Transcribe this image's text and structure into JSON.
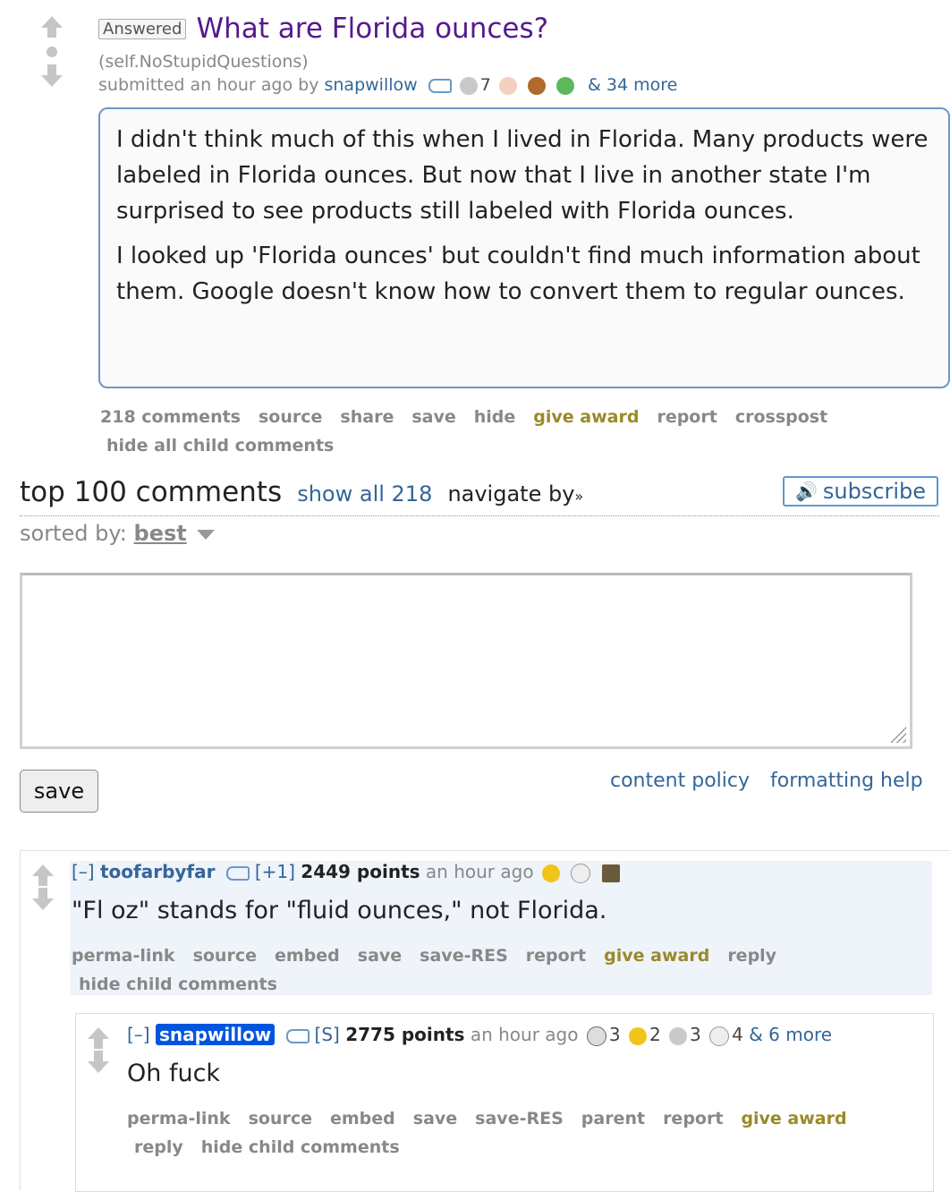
{
  "post": {
    "flair": "Answered",
    "title": "What are Florida ounces?",
    "domain": "(self.NoStupidQuestions)",
    "submitted": "submitted an hour ago by",
    "author": "snapwillow",
    "award_count_1": "7",
    "more_awards": "& 34 more",
    "body_p1": "I didn't think much of this when I lived in Florida. Many products were labeled in Florida ounces. But now that I live in another state I'm surprised to see products still labeled with Florida ounces.",
    "body_p2": "I looked up 'Florida ounces' but couldn't find much information about them. Google doesn't know how to convert them to regular ounces.",
    "buttons": {
      "comments": "218 comments",
      "source": "source",
      "share": "share",
      "save": "save",
      "hide": "hide",
      "give_award": "give award",
      "report": "report",
      "crosspost": "crosspost",
      "hide_child": "hide all child comments"
    }
  },
  "comments_panel": {
    "title": "top 100 comments",
    "show_all": "show all 218",
    "navigate": "navigate by",
    "subscribe": "subscribe",
    "sorted_by_label": "sorted by:",
    "sort_value": "best",
    "save_label": "save",
    "content_policy": "content policy",
    "formatting_help": "formatting help"
  },
  "comment1": {
    "collapse": "[–]",
    "author": "toofarbyfar",
    "karma": "[+1]",
    "points": "2449 points",
    "time": "an hour ago",
    "body": "\"Fl oz\" stands for \"fluid ounces,\" not Florida.",
    "buttons": {
      "permalink": "perma-link",
      "source": "source",
      "embed": "embed",
      "save": "save",
      "save_res": "save-RES",
      "report": "report",
      "give_award": "give award",
      "reply": "reply",
      "hide_child": "hide child comments"
    }
  },
  "comment2": {
    "collapse": "[–]",
    "author": "snapwillow",
    "tag": "[S]",
    "points": "2775 points",
    "time": "an hour ago",
    "award1": "3",
    "award2": "2",
    "award3": "3",
    "award4": "4",
    "more_awards": "& 6 more",
    "body": "Oh fuck",
    "buttons": {
      "permalink": "perma-link",
      "source": "source",
      "embed": "embed",
      "save": "save",
      "save_res": "save-RES",
      "parent": "parent",
      "report": "report",
      "give_award": "give award",
      "reply": "reply",
      "hide_child": "hide child comments"
    }
  },
  "colors": {
    "link": "#336699",
    "title": "#551a8b",
    "gold": "#9a8a27",
    "op_badge": "#0055df"
  }
}
